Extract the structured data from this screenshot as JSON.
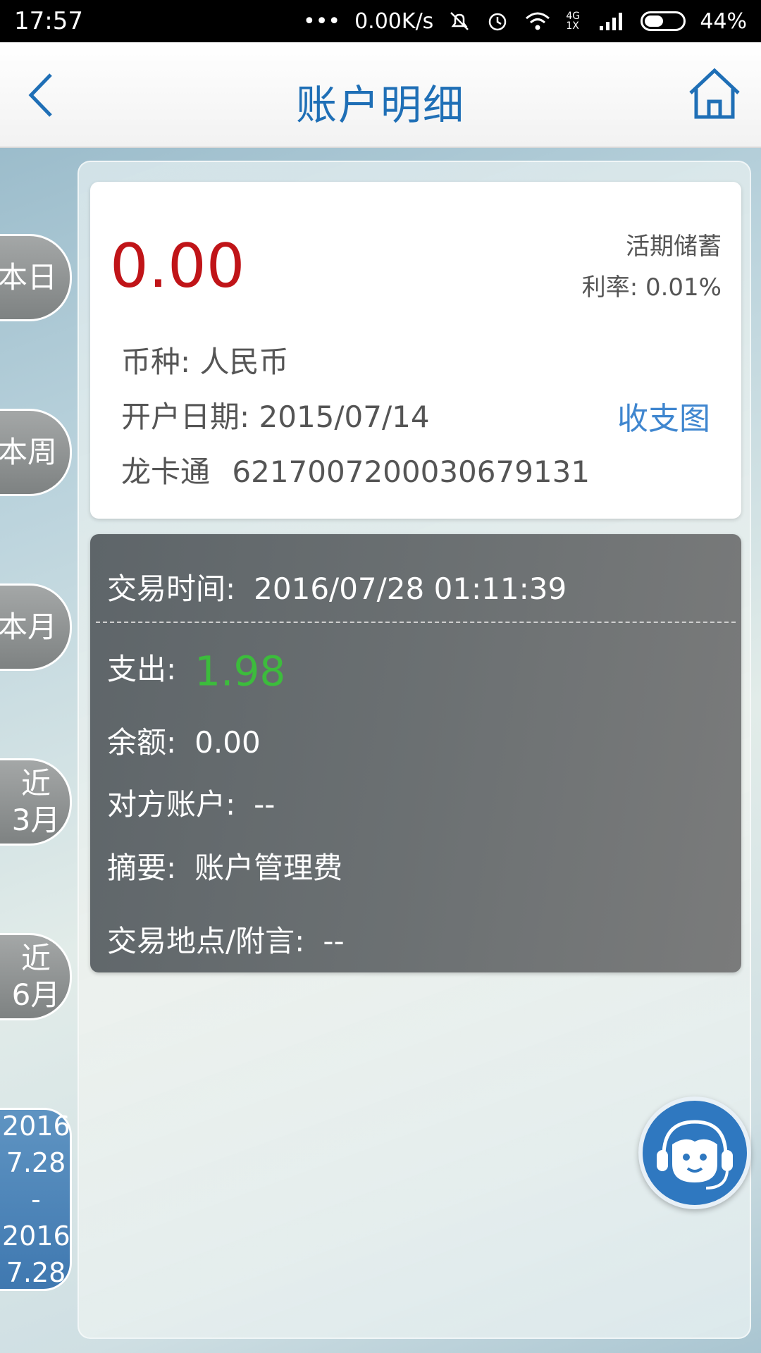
{
  "status_bar": {
    "time": "17:57",
    "network_speed": "0.00K/s",
    "network_type": "4G 1X",
    "battery": "44%",
    "battery_level": 0.44,
    "icons": [
      "more-dots-icon",
      "mute-icon",
      "alarm-icon",
      "wifi-icon",
      "signal-icon",
      "battery-icon"
    ]
  },
  "header": {
    "title": "账户明细",
    "back_icon": "chevron-left-icon",
    "home_icon": "home-icon",
    "accent_color": "#1f6fb6"
  },
  "account": {
    "balance": "0.00",
    "account_type": "活期储蓄",
    "interest_rate": "利率: 0.01%",
    "currency": "币种: 人民币",
    "open_date": "开户日期: 2015/07/14",
    "card_name": "龙卡通",
    "card_number": "6217007200030679131",
    "chart_link": "收支图",
    "balance_color": "#c01418"
  },
  "transaction": {
    "time_label": "交易时间:",
    "time_value": "2016/07/28 01:11:39",
    "expense_label": "支出:",
    "expense_value": "1.98",
    "balance_label": "余额:",
    "balance_value": "0.00",
    "counterparty_label": "对方账户:",
    "counterparty_value": "--",
    "summary_label": "摘要:",
    "summary_value": "账户管理费",
    "location_label": "交易地点/附言:",
    "location_value": "--",
    "expense_color": "#3cbc3c"
  },
  "side_tabs": {
    "day": "本日",
    "week": "本周",
    "month": "本月",
    "three_months_l1": "近",
    "three_months_l2": "3月",
    "six_months_l1": "近",
    "six_months_l2": "6月",
    "range_start_year": "2016",
    "range_start_date": "7.28",
    "range_sep": "-",
    "range_end_year": "2016",
    "range_end_date": "7.28"
  },
  "help": {
    "icon": "customer-service-icon"
  }
}
